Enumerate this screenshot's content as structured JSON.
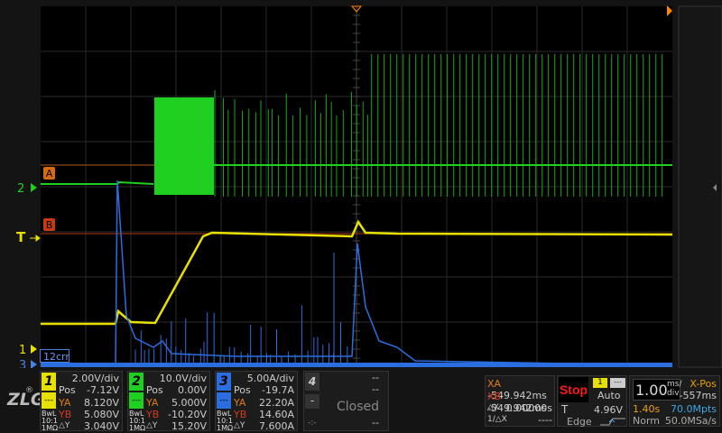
{
  "colors": {
    "ch1": "#e8e000",
    "ch2": "#20d020",
    "ch3": "#2a6ee0",
    "cursorA": "#d86a10",
    "cursorB": "#c83a10",
    "trigger": "#ff8800"
  },
  "markers": {
    "cursor_a": "A",
    "cursor_b": "B",
    "ch2": "2",
    "trigger": "T",
    "ch1": "1",
    "ch3": "3",
    "math_label": "12crr"
  },
  "channels": [
    {
      "num": "1",
      "scale": "2.00V/div",
      "pos_label": "Pos",
      "pos": "-7.12V",
      "ya_label": "YA",
      "ya": "8.120V",
      "yb_label": "YB",
      "yb": "5.080V",
      "dy_label": "△Y",
      "dy": "3.040V",
      "bw": "BwL",
      "probe": "10:1",
      "imp": "1MΩ"
    },
    {
      "num": "2",
      "scale": "10.0V/div",
      "pos_label": "Pos",
      "pos": "0.00V",
      "ya_label": "YA",
      "ya": "5.000V",
      "yb_label": "YB",
      "yb": "-10.20V",
      "dy_label": "△Y",
      "dy": "15.20V",
      "bw": "BwL",
      "probe": "10:1",
      "imp": "1MΩ"
    },
    {
      "num": "3",
      "scale": "5.00A/div",
      "pos_label": "Pos",
      "pos": "-19.7A",
      "ya_label": "YA",
      "ya": "22.20A",
      "yb_label": "YB",
      "yb": "14.60A",
      "dy_label": "△Y",
      "dy": "7.600A",
      "bw": "BwL",
      "probe": "10:1",
      "imp": "1MΩ"
    }
  ],
  "ch4": {
    "num": "4",
    "v1": "--",
    "v2": "--",
    "minus": "-",
    "status": "Closed",
    "v3": "--",
    "icon": "-:-"
  },
  "cursors": {
    "xa_label": "XA",
    "xa": "-549.942ms",
    "xb_label": "XB",
    "xb": "-549.942ms",
    "dx_label": "△X",
    "dx": "0.00000s",
    "inv_label": "1/△X",
    "inv": "----"
  },
  "trigger": {
    "state": "Stop",
    "source": "1",
    "mode": "Auto",
    "level_label": "T",
    "level": "4.96V",
    "type": "Edge"
  },
  "timebase": {
    "scale": "1.00",
    "unit_top": "ms/",
    "unit_bot": "div",
    "xpos_label": "X-Pos",
    "xpos": "-557ms",
    "duration": "1.40s",
    "points": "70.0Mpts",
    "acq": "Norm",
    "rate": "50.0MSa/s"
  },
  "logo": "ZLG"
}
